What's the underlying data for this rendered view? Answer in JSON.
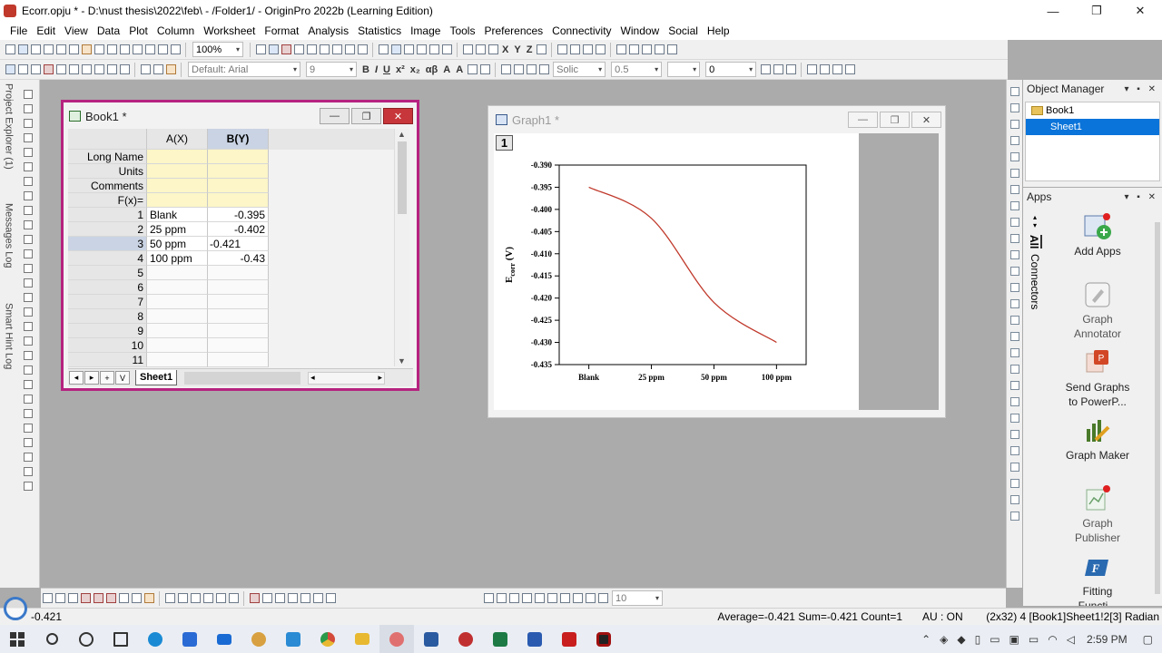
{
  "window": {
    "title": "Ecorr.opju * - D:\\nust thesis\\2022\\feb\\ - /Folder1/ - OriginPro 2022b (Learning Edition)",
    "minimize_glyph": "—",
    "maximize_glyph": "❐",
    "close_glyph": "✕"
  },
  "menu": [
    "File",
    "Edit",
    "View",
    "Data",
    "Plot",
    "Column",
    "Worksheet",
    "Format",
    "Analysis",
    "Statistics",
    "Image",
    "Tools",
    "Preferences",
    "Connectivity",
    "Window",
    "Social",
    "Help"
  ],
  "toolbar": {
    "zoom": "100%",
    "font": "Default: Arial",
    "font_size": "9",
    "line_style": "Solic",
    "line_width": "0.5",
    "rotation": "0",
    "text_buttons": [
      "B",
      "I",
      "U",
      "x²",
      "x₂",
      "αβ",
      "A",
      "A"
    ],
    "axis_buttons": [
      "X",
      "Y",
      "Z"
    ],
    "bottom_value": "10"
  },
  "side_tabs": [
    "Project Explorer (1)",
    "Messages Log",
    "Smart Hint Log"
  ],
  "book": {
    "title": "Book1 *",
    "columns": [
      "A(X)",
      "B(Y)"
    ],
    "meta_rows": [
      "Long Name",
      "Units",
      "Comments",
      "F(x)="
    ],
    "rows": [
      {
        "n": "1",
        "a": "Blank",
        "b": "-0.395"
      },
      {
        "n": "2",
        "a": "25 ppm",
        "b": "-0.402"
      },
      {
        "n": "3",
        "a": "50 ppm",
        "b": "-0.421"
      },
      {
        "n": "4",
        "a": "100 ppm",
        "b": "-0.43"
      },
      {
        "n": "5",
        "a": "",
        "b": ""
      },
      {
        "n": "6",
        "a": "",
        "b": ""
      },
      {
        "n": "7",
        "a": "",
        "b": ""
      },
      {
        "n": "8",
        "a": "",
        "b": ""
      },
      {
        "n": "9",
        "a": "",
        "b": ""
      },
      {
        "n": "10",
        "a": "",
        "b": ""
      },
      {
        "n": "11",
        "a": "",
        "b": ""
      }
    ],
    "sheet_tab": "Sheet1",
    "add_sheet": "+",
    "menu_v": "V"
  },
  "graph": {
    "title": "Graph1 *",
    "layer": "1",
    "ylabel_main": "E",
    "ylabel_sub": "corr",
    "ylabel_unit": " (V)"
  },
  "chart_data": {
    "type": "line",
    "categories": [
      "Blank",
      "25 ppm",
      "50 ppm",
      "100 ppm"
    ],
    "values": [
      -0.395,
      -0.402,
      -0.421,
      -0.43
    ],
    "title": "",
    "xlabel": "",
    "ylabel": "Ecorr (V)",
    "ylim": [
      -0.435,
      -0.39
    ],
    "yticks": [
      "-0.390",
      "-0.395",
      "-0.400",
      "-0.405",
      "-0.410",
      "-0.415",
      "-0.420",
      "-0.425",
      "-0.430",
      "-0.435"
    ],
    "line_color": "#c0392b",
    "grid": false,
    "legend": "none",
    "smooth": true
  },
  "object_manager": {
    "title": "Object Manager",
    "items": [
      "Book1",
      "Sheet1"
    ],
    "buttons": "▾ ▪ ✕"
  },
  "apps": {
    "title": "Apps",
    "tabs": [
      "All",
      "Connectors"
    ],
    "items": [
      {
        "label": "Add Apps",
        "icon": "add-apps-icon",
        "color": "#4aa64a"
      },
      {
        "label": "Graph\nAnnotator",
        "icon": "pencil-icon",
        "color": "#9a9a9a"
      },
      {
        "label": "Send Graphs\nto PowerP...",
        "icon": "powerpoint-icon",
        "color": "#d24726"
      },
      {
        "label": "Graph Maker",
        "icon": "graph-maker-icon",
        "color": "#4a7a2a"
      },
      {
        "label": "Graph\nPublisher",
        "icon": "graph-publisher-icon",
        "color": "#6aa06a"
      },
      {
        "label": "Fitting\nFuncti...",
        "icon": "fitting-icon",
        "color": "#2a6ab0"
      }
    ]
  },
  "status": {
    "left": "-0.421",
    "stats": "Average=-0.421 Sum=-0.421 Count=1",
    "au": "AU : ON",
    "right": "(2x32) 4 [Book1]Sheet1!2[3] Radian"
  },
  "taskbar": {
    "time": "2:59 PM",
    "apps": [
      {
        "name": "search-icon",
        "color": "#333"
      },
      {
        "name": "cortana-icon",
        "color": "#333"
      },
      {
        "name": "task-view-icon",
        "color": "#333"
      },
      {
        "name": "edge-icon",
        "color": "#1a8ad4"
      },
      {
        "name": "store-icon",
        "color": "#2a6ad4"
      },
      {
        "name": "mail-icon",
        "color": "#1a6ad4"
      },
      {
        "name": "paint-icon",
        "color": "#d8a040"
      },
      {
        "name": "notepad-icon",
        "color": "#2a8ad4"
      },
      {
        "name": "chrome-icon",
        "color": "#d44a3a"
      },
      {
        "name": "explorer-icon",
        "color": "#e8b830"
      },
      {
        "name": "origin-icon",
        "color": "#e07070"
      },
      {
        "name": "photos-icon",
        "color": "#2a5aa0"
      },
      {
        "name": "snip-icon",
        "color": "#c03030"
      },
      {
        "name": "excel-icon",
        "color": "#1d7a44"
      },
      {
        "name": "word-icon",
        "color": "#2a5ab0"
      },
      {
        "name": "acrobat-icon",
        "color": "#c81e1e"
      },
      {
        "name": "recorder-icon",
        "color": "#a01010"
      }
    ]
  }
}
